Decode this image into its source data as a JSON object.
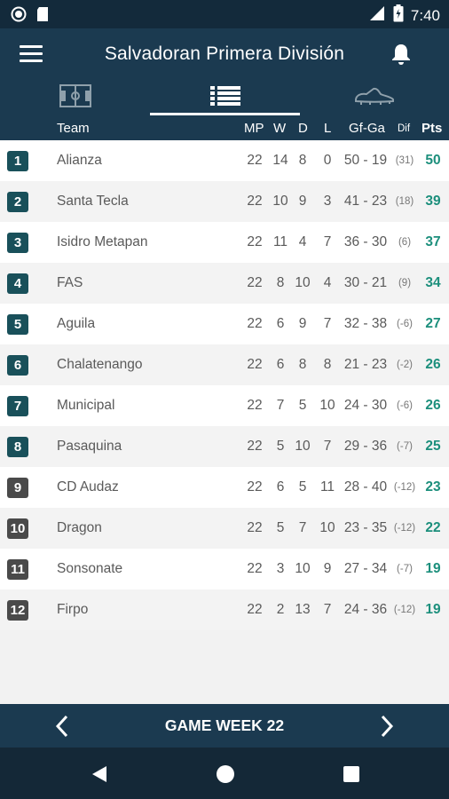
{
  "status_bar": {
    "time": "7:40",
    "network": "LTE"
  },
  "app": {
    "title": "Salvadoran Primera División"
  },
  "tabs": [
    {
      "icon": "pitch-icon",
      "active": false
    },
    {
      "icon": "list-icon",
      "active": true
    },
    {
      "icon": "boot-icon",
      "active": false
    }
  ],
  "table_header": {
    "team": "Team",
    "mp": "MP",
    "w": "W",
    "d": "D",
    "l": "L",
    "gfga": "Gf-Ga",
    "dif": "Dif",
    "pts": "Pts"
  },
  "standings": [
    {
      "rank": "1",
      "team": "Alianza",
      "mp": "22",
      "w": "14",
      "d": "8",
      "l": "0",
      "gfga": "50 - 19",
      "dif": "(31)",
      "pts": "50"
    },
    {
      "rank": "2",
      "team": "Santa Tecla",
      "mp": "22",
      "w": "10",
      "d": "9",
      "l": "3",
      "gfga": "41 - 23",
      "dif": "(18)",
      "pts": "39"
    },
    {
      "rank": "3",
      "team": "Isidro Metapan",
      "mp": "22",
      "w": "11",
      "d": "4",
      "l": "7",
      "gfga": "36 - 30",
      "dif": "(6)",
      "pts": "37"
    },
    {
      "rank": "4",
      "team": "FAS",
      "mp": "22",
      "w": "8",
      "d": "10",
      "l": "4",
      "gfga": "30 - 21",
      "dif": "(9)",
      "pts": "34"
    },
    {
      "rank": "5",
      "team": "Aguila",
      "mp": "22",
      "w": "6",
      "d": "9",
      "l": "7",
      "gfga": "32 - 38",
      "dif": "(-6)",
      "pts": "27"
    },
    {
      "rank": "6",
      "team": "Chalatenango",
      "mp": "22",
      "w": "6",
      "d": "8",
      "l": "8",
      "gfga": "21 - 23",
      "dif": "(-2)",
      "pts": "26"
    },
    {
      "rank": "7",
      "team": "Municipal",
      "mp": "22",
      "w": "7",
      "d": "5",
      "l": "10",
      "gfga": "24 - 30",
      "dif": "(-6)",
      "pts": "26"
    },
    {
      "rank": "8",
      "team": "Pasaquina",
      "mp": "22",
      "w": "5",
      "d": "10",
      "l": "7",
      "gfga": "29 - 36",
      "dif": "(-7)",
      "pts": "25"
    },
    {
      "rank": "9",
      "team": "CD Audaz",
      "mp": "22",
      "w": "6",
      "d": "5",
      "l": "11",
      "gfga": "28 - 40",
      "dif": "(-12)",
      "pts": "23"
    },
    {
      "rank": "10",
      "team": "Dragon",
      "mp": "22",
      "w": "5",
      "d": "7",
      "l": "10",
      "gfga": "23 - 35",
      "dif": "(-12)",
      "pts": "22"
    },
    {
      "rank": "11",
      "team": "Sonsonate",
      "mp": "22",
      "w": "3",
      "d": "10",
      "l": "9",
      "gfga": "27 - 34",
      "dif": "(-7)",
      "pts": "19"
    },
    {
      "rank": "12",
      "team": "Firpo",
      "mp": "22",
      "w": "2",
      "d": "13",
      "l": "7",
      "gfga": "24 - 36",
      "dif": "(-12)",
      "pts": "19"
    }
  ],
  "rank_colors": {
    "top": "#19505a",
    "bottom": "#4a4a4a"
  },
  "footer": {
    "label": "GAME WEEK 22"
  },
  "colors": {
    "primary": "#1b3a50",
    "status_bar": "#132a3b",
    "accent_points": "#1c8f7c"
  }
}
